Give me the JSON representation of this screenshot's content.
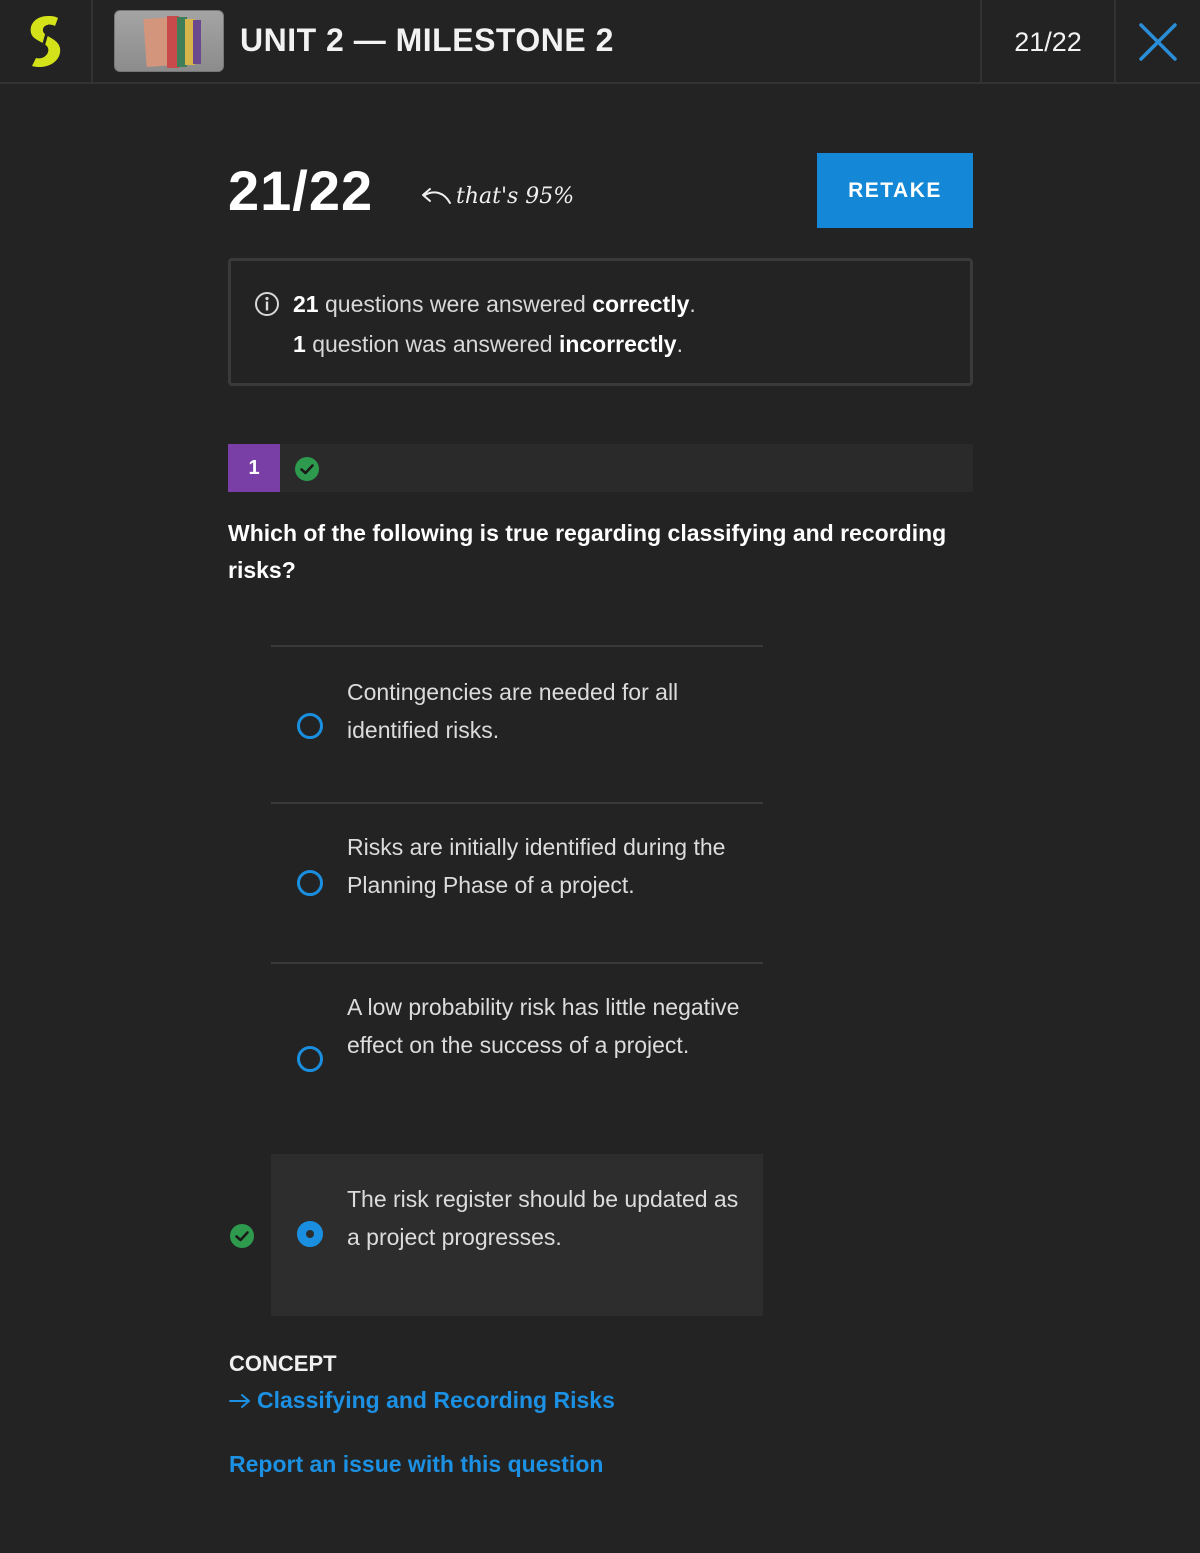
{
  "header": {
    "title": "UNIT 2 — MILESTONE 2",
    "progress": "21/22",
    "logo_icon": "sophia-logo-icon",
    "thumbnail_icon": "course-thumbnail-image",
    "close_icon": "close-icon"
  },
  "score": {
    "value": "21/22",
    "note": "that's 95%",
    "retake_label": "RETAKE"
  },
  "summary": {
    "correct_count": "21",
    "correct_text": "questions were answered",
    "correct_word": "correctly",
    "incorrect_count": "1",
    "incorrect_text": "question was answered",
    "incorrect_word": "incorrectly",
    "period": "."
  },
  "question": {
    "number": "1",
    "status": "correct",
    "text": "Which of the following is true regarding classifying and recording risks?",
    "choices": [
      {
        "text": "Contingencies are needed for all identified risks.",
        "selected": false
      },
      {
        "text": "Risks are initially identified during the Planning Phase of a project.",
        "selected": false
      },
      {
        "text": "A low probability risk has little negative effect on the success of a project.",
        "selected": false
      },
      {
        "text": "The risk register should be updated as a project progresses.",
        "selected": true
      }
    ]
  },
  "concept": {
    "label": "CONCEPT",
    "link": "Classifying and Recording Risks"
  },
  "report_link": "Report an issue with this question",
  "colors": {
    "background": "#232323",
    "accent_blue": "#1488d6",
    "correct_green": "#2e9a4e",
    "question_badge": "#7a3fa6",
    "logo_yellow": "#d4e21a"
  }
}
